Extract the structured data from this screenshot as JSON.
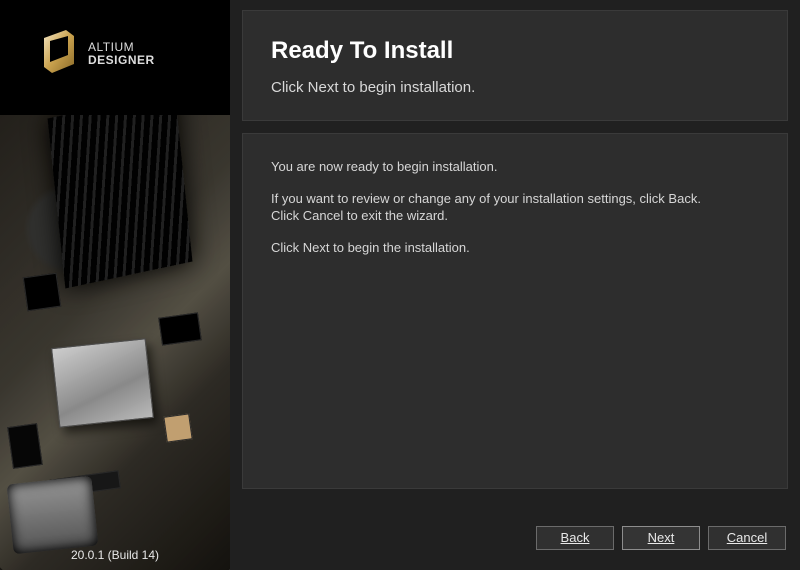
{
  "brand": {
    "line1": "ALTIUM",
    "line2": "DESIGNER"
  },
  "version": "20.0.1 (Build 14)",
  "header": {
    "title": "Ready To Install",
    "subtitle": "Click Next to begin installation."
  },
  "body": {
    "p1": "You are now ready to begin installation.",
    "p2": "If you want to review or change any of your installation settings, click Back.",
    "p3": "Click Cancel to exit the wizard.",
    "p4": "Click Next to begin the installation."
  },
  "buttons": {
    "back": "Back",
    "next": "Next",
    "cancel": "Cancel"
  }
}
